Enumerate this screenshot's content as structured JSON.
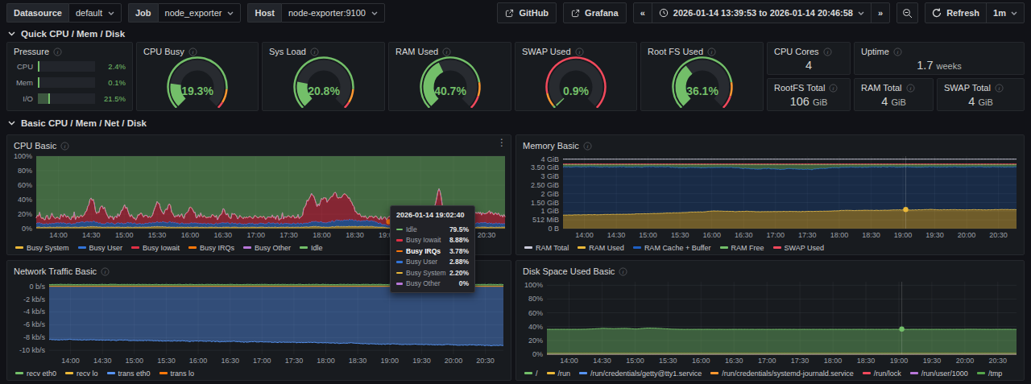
{
  "topbar": {
    "variables": [
      {
        "label": "Datasource",
        "value": "default"
      },
      {
        "label": "Job",
        "value": "node_exporter"
      },
      {
        "label": "Host",
        "value": "node-exporter:9100"
      }
    ],
    "links": [
      {
        "label": "GitHub"
      },
      {
        "label": "Grafana"
      }
    ],
    "time_range": "2026-01-14 13:39:53 to 2026-01-14 20:46:58",
    "refresh_label": "Refresh",
    "refresh_interval": "1m"
  },
  "sections": {
    "quick": "Quick CPU / Mem / Disk",
    "basic": "Basic CPU / Mem / Net / Disk"
  },
  "pressure": {
    "title": "Pressure",
    "rows": [
      {
        "label": "CPU",
        "value": "2.4%",
        "pct": 2.4
      },
      {
        "label": "Mem",
        "value": "0.1%",
        "pct": 0.1
      },
      {
        "label": "I/O",
        "value": "21.5%",
        "pct": 21.5
      }
    ]
  },
  "gauges": [
    {
      "title": "CPU Busy",
      "value": "19.3%",
      "pct": 19.3,
      "thresholds": [
        85,
        95
      ]
    },
    {
      "title": "Sys Load",
      "value": "20.8%",
      "pct": 20.8,
      "thresholds": [
        85,
        95
      ]
    },
    {
      "title": "RAM Used",
      "value": "40.7%",
      "pct": 40.7,
      "thresholds": [
        80,
        90
      ]
    },
    {
      "title": "SWAP Used",
      "value": "0.9%",
      "pct": 0.9,
      "thresholds": [
        2,
        12
      ]
    },
    {
      "title": "Root FS Used",
      "value": "36.1%",
      "pct": 36.1,
      "thresholds": [
        80,
        90
      ]
    }
  ],
  "stats": [
    {
      "title": "CPU Cores",
      "value": "4",
      "unit": ""
    },
    {
      "title": "Uptime",
      "value": "1.7",
      "unit": "weeks"
    },
    {
      "title": "RootFS Total",
      "value": "106",
      "unit": "GiB"
    },
    {
      "title": "RAM Total",
      "value": "4",
      "unit": "GiB"
    },
    {
      "title": "SWAP Total",
      "value": "4",
      "unit": "GiB"
    }
  ],
  "tooltip": {
    "time": "2026-01-14 19:02:40",
    "rows": [
      {
        "label": "Idle",
        "value": "79.5%",
        "color": "#73bf69",
        "bold": false
      },
      {
        "label": "Busy Iowait",
        "value": "8.88%",
        "color": "#e02f44",
        "bold": false
      },
      {
        "label": "Busy IRQs",
        "value": "3.78%",
        "color": "#ff780a",
        "bold": true
      },
      {
        "label": "Busy User",
        "value": "2.88%",
        "color": "#3274d9",
        "bold": false
      },
      {
        "label": "Busy System",
        "value": "2.20%",
        "color": "#eab839",
        "bold": false
      },
      {
        "label": "Busy Other",
        "value": "0%",
        "color": "#b877d9",
        "bold": false
      }
    ]
  },
  "chart_data": [
    {
      "type": "area",
      "title": "CPU Basic",
      "stacked": true,
      "ylim": [
        0,
        100
      ],
      "yticks": [
        [
          0,
          "0%"
        ],
        [
          20,
          "20%"
        ],
        [
          40,
          "40%"
        ],
        [
          60,
          "60%"
        ],
        [
          80,
          "80%"
        ],
        [
          100,
          "100%"
        ]
      ],
      "x_start_h": 13.6647,
      "x_end_h": 20.7828,
      "xticks": [
        [
          14,
          "14:00"
        ],
        [
          14.5,
          "14:30"
        ],
        [
          15,
          "15:00"
        ],
        [
          15.5,
          "15:30"
        ],
        [
          16,
          "16:00"
        ],
        [
          16.5,
          "16:30"
        ],
        [
          17,
          "17:00"
        ],
        [
          17.5,
          "17:30"
        ],
        [
          18,
          "18:00"
        ],
        [
          18.5,
          "18:30"
        ],
        [
          19,
          "19:00"
        ],
        [
          19.5,
          "19:30"
        ],
        [
          20,
          "20:00"
        ],
        [
          20.5,
          "20:30"
        ]
      ],
      "series": [
        {
          "name": "Busy System",
          "color": "#eab839",
          "jitter": 0.4,
          "fill_opacity": 0.55,
          "values": [
            2,
            2,
            2,
            2,
            2,
            3,
            2,
            2,
            2,
            2,
            2,
            3,
            2,
            2,
            2,
            2,
            2,
            2,
            2,
            2,
            2,
            2,
            2,
            2,
            2,
            3,
            2,
            3,
            3,
            3,
            3,
            2,
            1,
            1,
            2,
            2,
            2,
            2,
            4,
            2,
            2,
            2,
            2
          ]
        },
        {
          "name": "Busy User",
          "color": "#3274d9",
          "jitter": 1.0,
          "fill_opacity": 0.55,
          "values": [
            5,
            5,
            6,
            5,
            6,
            7,
            5,
            5,
            6,
            5,
            5,
            6,
            7,
            5,
            6,
            5,
            5,
            6,
            5,
            5,
            5,
            6,
            5,
            5,
            5,
            7,
            6,
            8,
            9,
            8,
            8,
            4,
            3,
            3,
            4,
            5,
            4,
            5,
            8,
            5,
            6,
            5,
            5
          ]
        },
        {
          "name": "Busy Iowait",
          "color": "#e02f44",
          "jitter": 2.8,
          "spikey": true,
          "fill_opacity": 0.55,
          "values": [
            8,
            6,
            9,
            7,
            6,
            10,
            7,
            8,
            6,
            12,
            34,
            12,
            25,
            9,
            7,
            11,
            26,
            9,
            7,
            13,
            8,
            10,
            30,
            10,
            24,
            8,
            11,
            9,
            24,
            9,
            12,
            8,
            10,
            7,
            18,
            8,
            12,
            7,
            9,
            8,
            10,
            7,
            9,
            8,
            7,
            9,
            8,
            10,
            7,
            28,
            40,
            20,
            35,
            28,
            38,
            30,
            36,
            28,
            10,
            6,
            4,
            5,
            6,
            8,
            10,
            12,
            10,
            9,
            11,
            10,
            9,
            10,
            11,
            52,
            10,
            12,
            16,
            14,
            12,
            15,
            13,
            11,
            16,
            13,
            11,
            10
          ]
        },
        {
          "name": "Busy IRQs",
          "color": "#ff780a",
          "const": 0.5,
          "fill_opacity": 0.55
        },
        {
          "name": "Busy Other",
          "color": "#b877d9",
          "const": 0,
          "fill_opacity": 0.55
        },
        {
          "name": "Idle",
          "color": "#73bf69",
          "fill_to": 100,
          "fill_opacity": 0.48
        }
      ],
      "legend": [
        [
          "Busy System",
          "#eab839"
        ],
        [
          "Busy User",
          "#3274d9"
        ],
        [
          "Busy Iowait",
          "#e02f44"
        ],
        [
          "Busy IRQs",
          "#ff780a"
        ],
        [
          "Busy Other",
          "#b877d9"
        ],
        [
          "Idle",
          "#73bf69"
        ]
      ],
      "hover": {
        "frac": 0.752,
        "dot_y": 9.5,
        "dot_color": "#ff780a",
        "line": false
      }
    },
    {
      "type": "area",
      "title": "Memory Basic",
      "stacked": true,
      "ylim": [
        0,
        4.16
      ],
      "yticks": [
        [
          0,
          "0 B"
        ],
        [
          0.5,
          "512 MiB"
        ],
        [
          1,
          "1 GiB"
        ],
        [
          1.5,
          "1.50 GiB"
        ],
        [
          2,
          "2 GiB"
        ],
        [
          2.5,
          "2.50 GiB"
        ],
        [
          3,
          "3 GiB"
        ],
        [
          3.5,
          "3.50 GiB"
        ],
        [
          4,
          "4 GiB"
        ]
      ],
      "x_start_h": 13.6647,
      "x_end_h": 20.7828,
      "xticks": [
        [
          14,
          "14:00"
        ],
        [
          14.5,
          "14:30"
        ],
        [
          15,
          "15:00"
        ],
        [
          15.5,
          "15:30"
        ],
        [
          16,
          "16:00"
        ],
        [
          16.5,
          "16:30"
        ],
        [
          17,
          "17:00"
        ],
        [
          17.5,
          "17:30"
        ],
        [
          18,
          "18:00"
        ],
        [
          18.5,
          "18:30"
        ],
        [
          19,
          "19:00"
        ],
        [
          19.5,
          "19:30"
        ],
        [
          20,
          "20:00"
        ],
        [
          20.5,
          "20:30"
        ]
      ],
      "series": [
        {
          "name": "RAM Used",
          "color": "#eab839",
          "jitter": 0.008,
          "fill_opacity": 0.42,
          "values": [
            0.78,
            0.79,
            0.8,
            0.8,
            0.81,
            0.82,
            0.83,
            0.85,
            0.86,
            0.88,
            0.9,
            0.92,
            0.95,
            0.96,
            1.02,
            1.0,
            0.98,
            1.0,
            0.97,
            0.98,
            0.98,
            0.99,
            0.98,
            0.99,
            1.0,
            1.02,
            1.05,
            1.04,
            1.06,
            1.05,
            1.06,
            1.08,
            1.07,
            1.08,
            1.1,
            1.08,
            1.09,
            1.08,
            1.09,
            1.08,
            1.09,
            1.1,
            1.09
          ]
        },
        {
          "name": "RAM Cache + Buffer",
          "color": "#1f60c4",
          "jitter": 0.02,
          "fill_opacity": 0.24,
          "values": [
            2.77,
            2.76,
            2.76,
            2.75,
            2.73,
            2.73,
            2.72,
            2.69,
            2.69,
            2.67,
            2.64,
            2.58,
            2.57,
            2.54,
            2.5,
            2.53,
            2.52,
            2.45,
            2.45,
            2.47,
            2.42,
            2.45,
            2.44,
            2.41,
            2.45,
            2.48,
            2.47,
            2.5,
            2.47,
            2.49,
            2.49,
            2.46,
            2.48,
            2.46,
            2.45,
            2.46,
            2.46,
            2.46,
            2.46,
            2.46,
            2.46,
            2.44,
            2.46
          ]
        },
        {
          "name": "RAM Free",
          "color": "#73bf69",
          "fill_to": 3.67,
          "fill_opacity": 0.4
        },
        {
          "name": "SWAP Used",
          "color": "#f2495c",
          "const": 3.71,
          "type": "line"
        },
        {
          "name": "RAM Total",
          "color": "#ccccdc",
          "const": 3.99,
          "type": "line"
        }
      ],
      "legend": [
        [
          "RAM Total",
          "#ccccdc"
        ],
        [
          "RAM Used",
          "#eab839"
        ],
        [
          "RAM Cache + Buffer",
          "#1f60c4"
        ],
        [
          "RAM Free",
          "#73bf69"
        ],
        [
          "SWAP Used",
          "#f2495c"
        ]
      ],
      "hover": {
        "frac": 0.7557,
        "dot_y": 1.1,
        "dot_color": "#eab839",
        "line": true
      }
    },
    {
      "type": "area",
      "title": "Network Traffic Basic",
      "stacked": false,
      "ylim": [
        -10.6,
        0.7
      ],
      "yticks": [
        [
          0,
          "0 b/s"
        ],
        [
          -2,
          "-2 kb/s"
        ],
        [
          -4,
          "-4 kb/s"
        ],
        [
          -6,
          "-6 kb/s"
        ],
        [
          -8,
          "-8 kb/s"
        ],
        [
          -10,
          "-10 kb/s"
        ]
      ],
      "x_start_h": 13.6647,
      "x_end_h": 20.7828,
      "xticks": [
        [
          14,
          "14:00"
        ],
        [
          14.5,
          "14:30"
        ],
        [
          15,
          "15:00"
        ],
        [
          15.5,
          "15:30"
        ],
        [
          16,
          "16:00"
        ],
        [
          16.5,
          "16:30"
        ],
        [
          17,
          "17:00"
        ],
        [
          17.5,
          "17:30"
        ],
        [
          18,
          "18:00"
        ],
        [
          18.5,
          "18:30"
        ],
        [
          19,
          "19:00"
        ],
        [
          19.5,
          "19:30"
        ],
        [
          20,
          "20:00"
        ],
        [
          20.5,
          "20:30"
        ]
      ],
      "series": [
        {
          "name": "trans eth0",
          "color": "#5794f2",
          "jitter": 0.05,
          "fill_opacity": 0.42,
          "values": [
            -8.3,
            -8.35,
            -8.3,
            -8.4,
            -8.35,
            -8.4,
            -8.45,
            -8.4,
            -8.5,
            -8.45,
            -8.5,
            -8.55,
            -8.5,
            -8.6,
            -8.55,
            -8.6,
            -8.65,
            -8.6,
            -8.7,
            -8.65,
            -8.7,
            -8.75,
            -8.7,
            -8.8,
            -8.75,
            -8.8,
            -8.85,
            -8.9,
            -8.85,
            -8.95,
            -9.0,
            -9.05,
            -9.0,
            -9.1,
            -9.05,
            -9.1,
            -9.15,
            -9.1,
            -9.2,
            -9.15,
            -9.2,
            -9.25,
            -9.2
          ]
        },
        {
          "name": "recv lo",
          "color": "#eab839",
          "const": 0,
          "type": "line"
        },
        {
          "name": "trans lo",
          "color": "#ff780a",
          "const": 0,
          "type": "line"
        },
        {
          "name": "recv eth0",
          "color": "#73bf69",
          "const": 0.28,
          "jitter": 0.03,
          "fill_opacity": 0.5
        }
      ],
      "legend": [
        [
          "recv eth0",
          "#73bf69"
        ],
        [
          "recv lo",
          "#eab839"
        ],
        [
          "trans eth0",
          "#5794f2"
        ],
        [
          "trans lo",
          "#ff780a"
        ]
      ],
      "hover": null
    },
    {
      "type": "area",
      "title": "Disk Space Used Basic",
      "stacked": false,
      "ylim": [
        0,
        105
      ],
      "yticks": [
        [
          0,
          "0%"
        ],
        [
          20,
          "20%"
        ],
        [
          40,
          "40%"
        ],
        [
          60,
          "60%"
        ],
        [
          80,
          "80%"
        ],
        [
          100,
          "100%"
        ]
      ],
      "x_start_h": 13.6647,
      "x_end_h": 20.7828,
      "xticks": [
        [
          14,
          "14:00"
        ],
        [
          14.5,
          "14:30"
        ],
        [
          15,
          "15:00"
        ],
        [
          15.5,
          "15:30"
        ],
        [
          16,
          "16:00"
        ],
        [
          16.5,
          "16:30"
        ],
        [
          17,
          "17:00"
        ],
        [
          17.5,
          "17:30"
        ],
        [
          18,
          "18:00"
        ],
        [
          18.5,
          "18:30"
        ],
        [
          19,
          "19:00"
        ],
        [
          19.5,
          "19:30"
        ],
        [
          20,
          "20:00"
        ],
        [
          20.5,
          "20:30"
        ]
      ],
      "series": [
        {
          "name": "/",
          "color": "#73bf69",
          "jitter": 0.08,
          "fill_opacity": 0.42,
          "values": [
            36,
            36,
            36,
            36,
            36.5,
            37.5,
            37,
            37.5,
            36.5,
            38,
            37.5,
            36.5,
            36,
            36,
            36,
            36,
            36,
            36,
            36,
            36,
            36,
            36,
            36,
            36,
            36,
            36,
            36,
            36,
            36,
            36,
            36,
            36,
            36,
            36,
            36,
            36,
            36,
            36,
            36.2,
            36,
            36,
            36,
            36
          ]
        },
        {
          "name": "/run",
          "color": "#eab839",
          "const": 1,
          "type": "line"
        },
        {
          "name": "/run/credentials/getty@tty1.service",
          "color": "#5794f2",
          "const": 0.2,
          "type": "line"
        },
        {
          "name": "/run/credentials/systemd-journald.service",
          "color": "#ff9830",
          "const": 0.2,
          "type": "line"
        },
        {
          "name": "/run/lock",
          "color": "#f2495c",
          "const": 0.2,
          "type": "line"
        },
        {
          "name": "/run/user/1000",
          "color": "#b877d9",
          "const": 0.2,
          "type": "line"
        },
        {
          "name": "/tmp",
          "color": "#56a64b",
          "const": 0.2,
          "type": "line"
        }
      ],
      "legend": [
        [
          "/",
          "#73bf69"
        ],
        [
          "/run",
          "#eab839"
        ],
        [
          "/run/credentials/getty@tty1.service",
          "#5794f2"
        ],
        [
          "/run/credentials/systemd-journald.service",
          "#ff9830"
        ],
        [
          "/run/lock",
          "#f2495c"
        ],
        [
          "/run/user/1000",
          "#b877d9"
        ],
        [
          "/tmp",
          "#56a64b"
        ]
      ],
      "hover": {
        "frac": 0.7557,
        "dot_y": 36.4,
        "dot_color": "#73bf69",
        "line": true
      }
    }
  ]
}
